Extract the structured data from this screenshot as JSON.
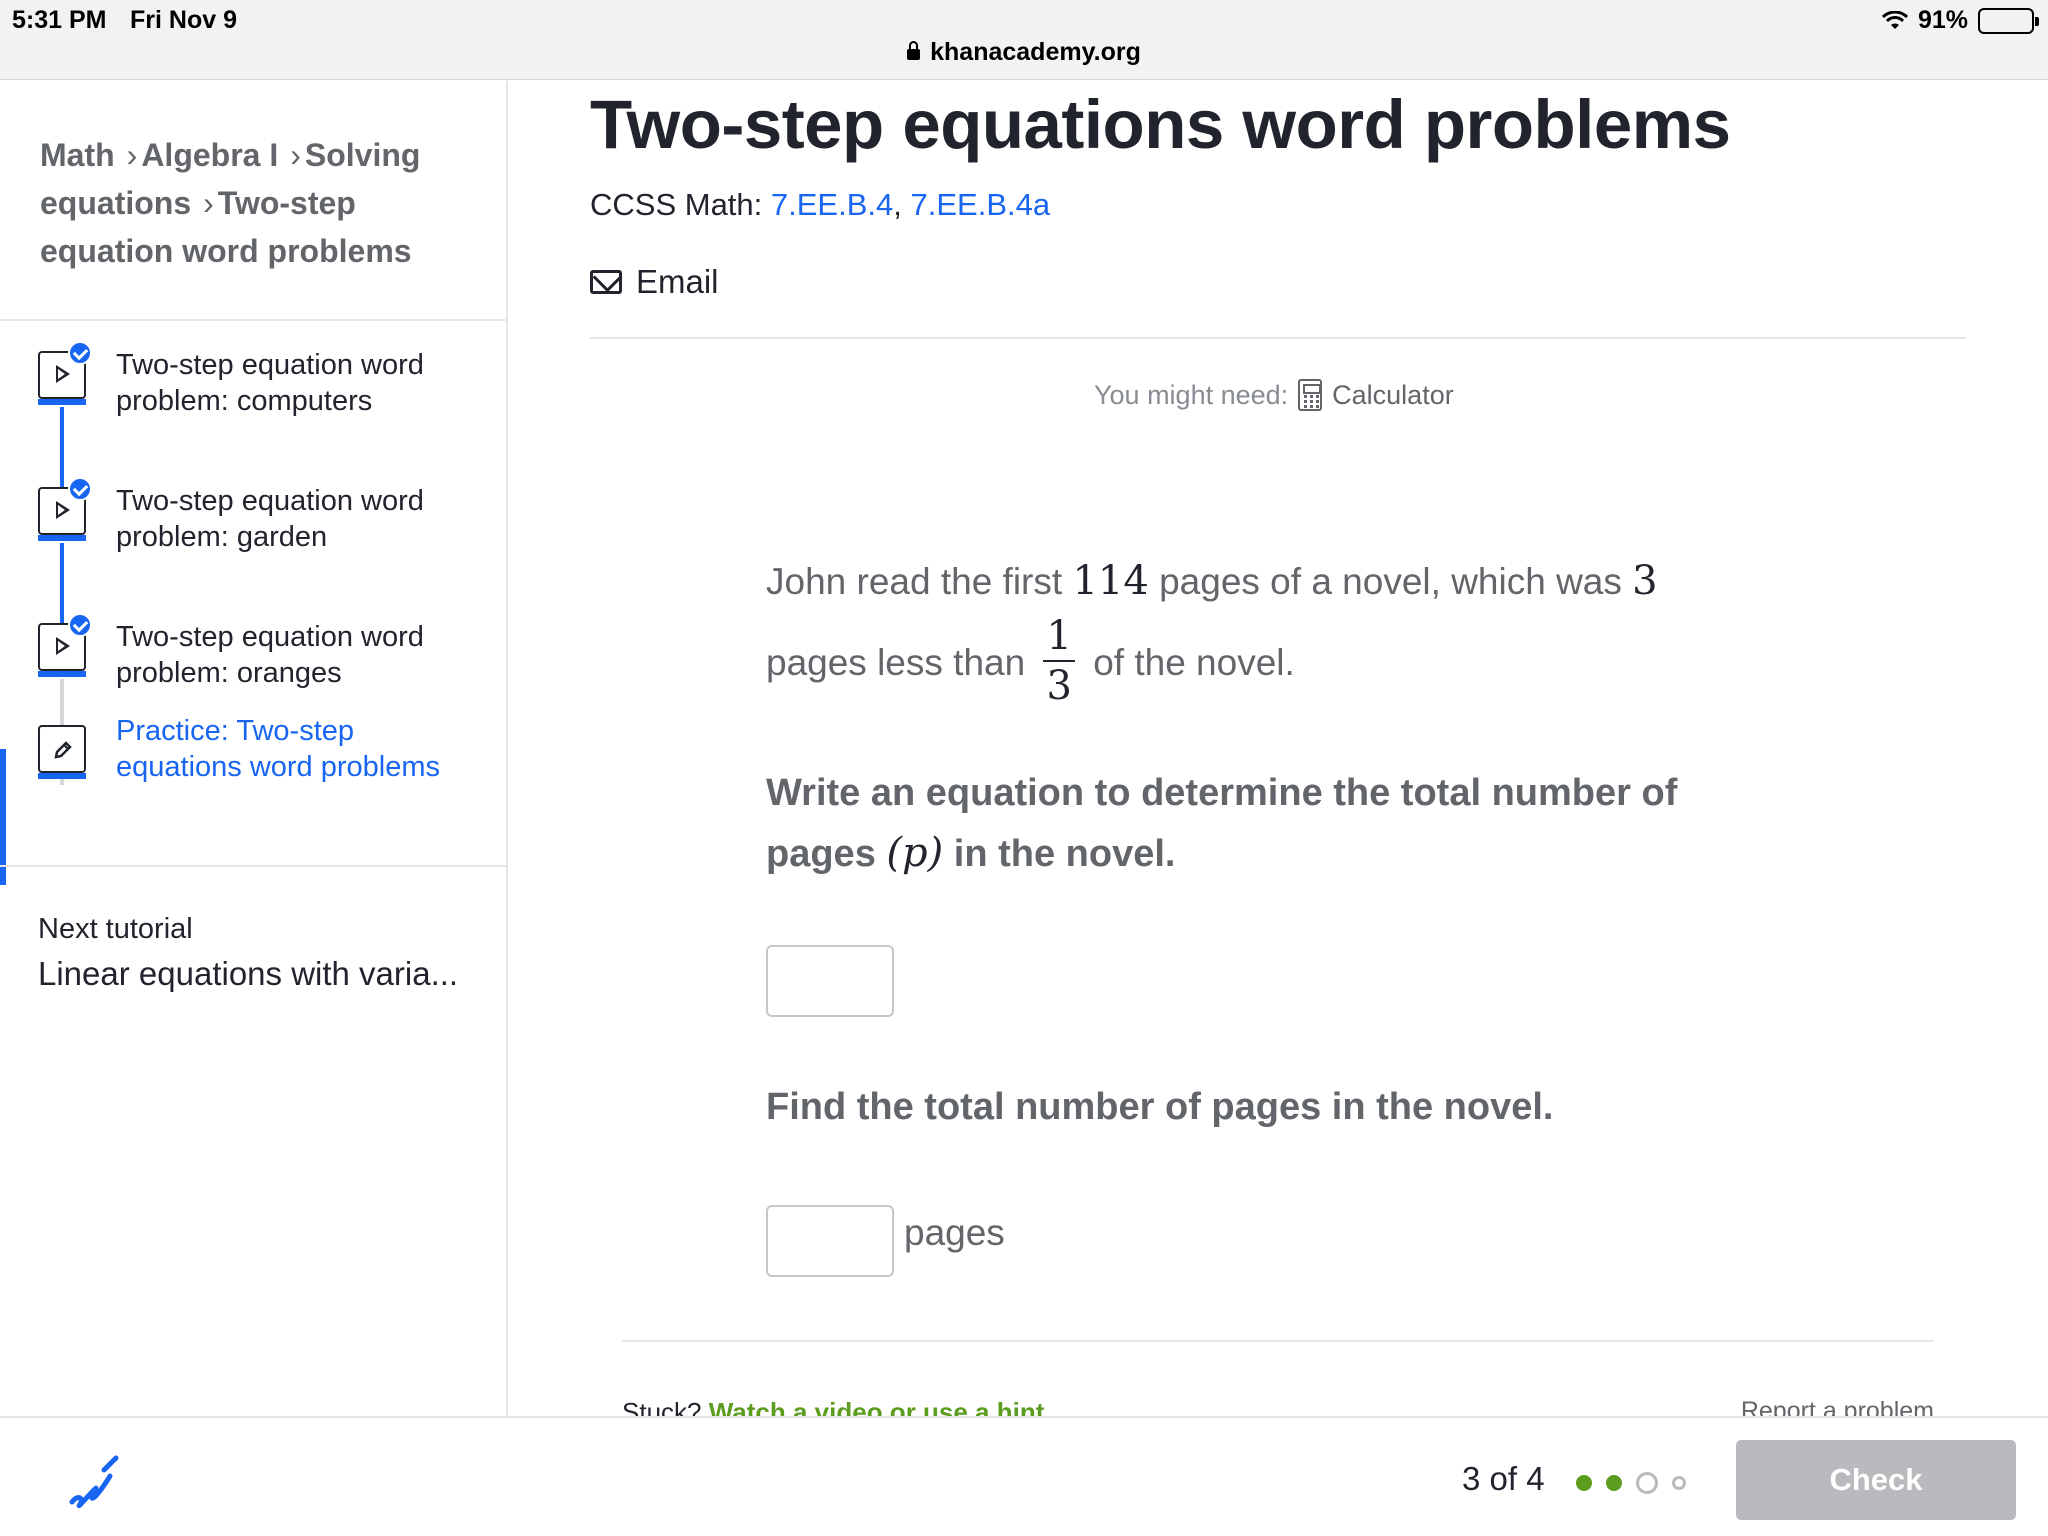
{
  "status_bar": {
    "time": "5:31 PM",
    "date": "Fri Nov 9",
    "battery": "91%",
    "battery_level": 0.91,
    "url": "khanacademy.org"
  },
  "sidebar": {
    "breadcrumb": [
      "Math",
      "Algebra I",
      "Solving equations",
      "Two-step equation word problems"
    ],
    "items": [
      {
        "label": "Two-step equation word problem: computers",
        "type": "video",
        "completed": true
      },
      {
        "label": "Two-step equation word problem: garden",
        "type": "video",
        "completed": true
      },
      {
        "label": "Two-step equation word problem: oranges",
        "type": "video",
        "completed": true
      },
      {
        "label": "Practice: Two-step equations word problems",
        "type": "exercise",
        "completed": false,
        "active": true
      }
    ],
    "next_tutorial_label": "Next tutorial",
    "next_tutorial_title": "Linear equations with varia..."
  },
  "main": {
    "title": "Two-step equations word problems",
    "ccss_label": "CCSS Math:",
    "ccss_sep": ",",
    "ccss_links": [
      "7.EE.B.4",
      "7.EE.B.4a"
    ],
    "email_label": "Email",
    "might_need_label": "You might need:",
    "calculator_label": "Calculator",
    "question": {
      "part1": "John read the first",
      "n1": "114",
      "part2": "pages of a novel, which was",
      "n2": "3",
      "part3": "pages less than",
      "frac_num": "1",
      "frac_den": "3",
      "part4": "of the novel."
    },
    "prompt1_a": "Write an equation to determine the total number of pages",
    "prompt1_var": "(p)",
    "prompt1_b": "in the novel.",
    "prompt2": "Find the total number of pages in the novel.",
    "input1_value": "",
    "input2_value": "",
    "unit": "pages",
    "stuck_label": "Stuck?",
    "hint_link": "Watch a video or use a hint",
    "report_link": "Report a problem"
  },
  "footer": {
    "progress": "3 of 4",
    "dots": [
      "done",
      "done",
      "current",
      "todo"
    ],
    "check_label": "Check"
  },
  "colors": {
    "accent_blue": "#1865f2",
    "success_green": "#5c9c1f",
    "disabled_gray": "#b8babd"
  }
}
